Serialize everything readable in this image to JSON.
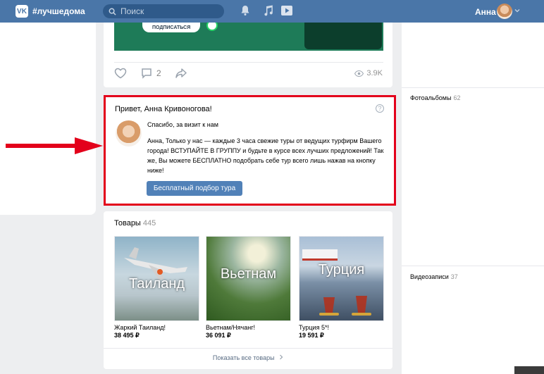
{
  "header": {
    "brand": "#лучшедома",
    "search_placeholder": "Поиск",
    "user_name": "Анна",
    "colors": {
      "bar": "#4a76a8"
    }
  },
  "post": {
    "subscribe_label": "ПОДПИСАТЬСЯ",
    "comments_count": "2",
    "views_count": "3.9K"
  },
  "welcome": {
    "title": "Привет, Анна Кривоногова!",
    "help": "?",
    "subtitle": "Спасибо, за визит к нам",
    "text": "Анна, Только у нас — каждые 3 часа свежие туры от ведущих турфирм Вашего города! ВСТУПАЙТЕ В ГРУППУ и будьте в курсе всех лучших предложений! Так же, Вы можете БЕСПЛАТНО подобрать себе тур всего лишь нажав на кнопку ниже!",
    "button": "Бесплатный подбор тура",
    "border_color": "#e3001b"
  },
  "goods": {
    "title": "Товары",
    "count": "445",
    "items": [
      {
        "image_word": "Таиланд",
        "name": "Жаркий Таиланд!",
        "price": "38 495 ₽"
      },
      {
        "image_word": "Вьетнам",
        "name": "Вьетнам/Нячанг!",
        "price": "36 091 ₽"
      },
      {
        "image_word": "Турция",
        "name": "Турция 5*!",
        "price": "19 591 ₽"
      }
    ],
    "more": "Показать все товары"
  },
  "right": {
    "albums_title": "Фотоальбомы",
    "albums_count": "62",
    "videos_title": "Видеозаписи",
    "videos_count": "37"
  }
}
